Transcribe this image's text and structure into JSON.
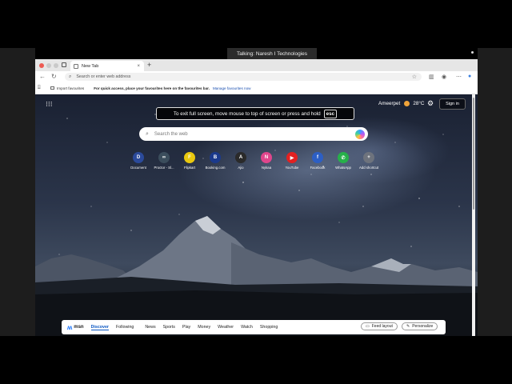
{
  "meeting": {
    "talking": "Talking: Naresh I Technologies"
  },
  "browser": {
    "tab_title": "New Tab",
    "tab_close": "×",
    "new_tab": "+",
    "address_placeholder": "Search or enter web address",
    "favourites_import": "Import favourites",
    "favourites_message": "For quick access, place your favourites here on the favourites bar.",
    "favourites_link": "Manage favourites now"
  },
  "newtab": {
    "location": "Ameerpet",
    "temperature": "28°C",
    "signin": "Sign in",
    "fullscreen_message": "To exit full screen, move mouse to top of screen or press and hold",
    "esc_key": "esc",
    "search_placeholder": "Search the web",
    "shortcuts": [
      {
        "label": "Document",
        "glyph": "D",
        "color": "#2b4a9a"
      },
      {
        "label": "Proctor - Sl...",
        "glyph": "∞",
        "color": "#3b4d5c"
      },
      {
        "label": "Flipkart",
        "glyph": "F",
        "color": "#e9c80f"
      },
      {
        "label": "Booking.com",
        "glyph": "B",
        "color": "#1b3a8c"
      },
      {
        "label": "Ajio",
        "glyph": "A",
        "color": "#2a2a2a"
      },
      {
        "label": "Nykaa",
        "glyph": "N",
        "color": "#e0468c"
      },
      {
        "label": "YouTube",
        "glyph": "▶",
        "color": "#e32121"
      },
      {
        "label": "Facebook",
        "glyph": "f",
        "color": "#2d5fc4"
      },
      {
        "label": "WhatsApp",
        "glyph": "✆",
        "color": "#27b04a"
      },
      {
        "label": "Add shortcut",
        "glyph": "+",
        "color": "#6e737d"
      }
    ]
  },
  "msn": {
    "logo": "msn",
    "tabs": [
      "Discover",
      "Following",
      "News",
      "Sports",
      "Play",
      "Money",
      "Weather",
      "Watch",
      "Shopping"
    ],
    "feed_layout": "Feed layout",
    "personalize": "Personalize"
  },
  "colors": {
    "accent": "#0b57c2",
    "bar_bg": "#e6e6e6"
  }
}
